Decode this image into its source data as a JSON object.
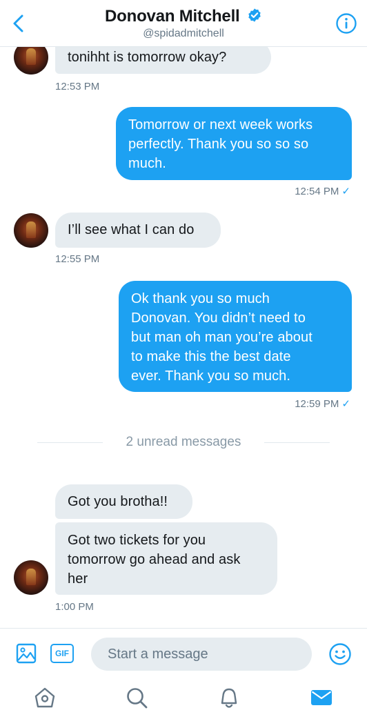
{
  "header": {
    "name": "Donovan Mitchell",
    "handle": "@spidadmitchell"
  },
  "messages": [
    {
      "direction": "in",
      "text": "tonihht is tomorrow okay?",
      "time": "12:53 PM"
    },
    {
      "direction": "out",
      "lines": [
        "Tomorrow or next week works",
        "perfectly. Thank you so so so",
        "much."
      ],
      "time": "12:54 PM"
    },
    {
      "direction": "in",
      "text": "I’ll see what I can do",
      "time": "12:55 PM"
    },
    {
      "direction": "out",
      "lines": [
        "Ok thank you so much",
        "Donovan. You didn’t need to",
        "but man oh man you’re about",
        "to make this the best date",
        "ever. Thank you so much."
      ],
      "time": "12:59 PM"
    },
    {
      "direction": "in",
      "text": "Got you brotha!!"
    },
    {
      "direction": "in",
      "lines": [
        "Got two tickets for you",
        "tomorrow go ahead and ask",
        "her"
      ],
      "time": "1:00 PM"
    }
  ],
  "read_check": "✓",
  "unread_divider": "2 unread messages",
  "composer": {
    "gif_label": "GIF",
    "placeholder": "Start a message"
  },
  "icons": {
    "back": "chevron-left-icon",
    "verified": "verified-badge-icon",
    "info": "info-icon",
    "media": "image-icon",
    "emoji": "smiley-icon",
    "home": "home-icon",
    "search": "search-icon",
    "notifications": "bell-icon",
    "messages": "envelope-icon"
  },
  "colors": {
    "accent": "#1da1f2",
    "incoming_bubble": "#e6ecf0",
    "secondary_text": "#657786"
  }
}
